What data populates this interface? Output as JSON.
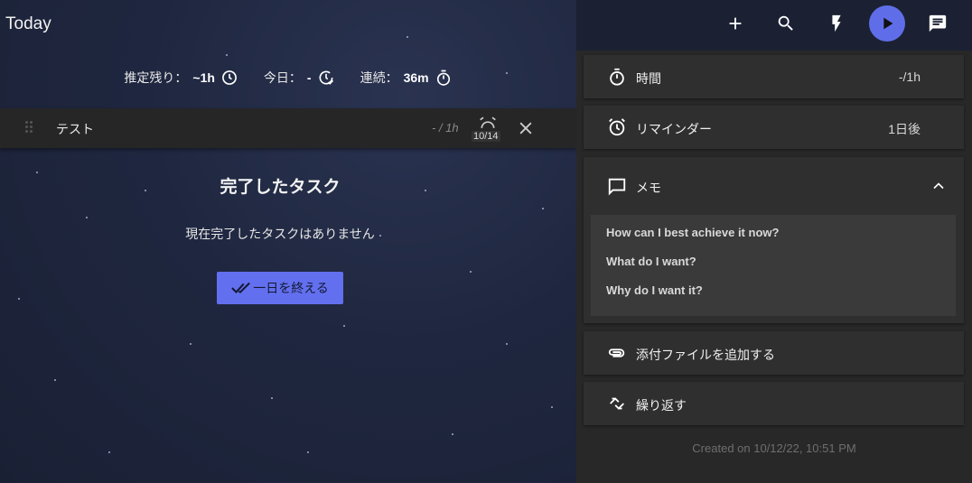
{
  "header": {
    "title": "Today",
    "actions": [
      "add-icon",
      "search-icon",
      "bolt-icon",
      "play-icon",
      "chat-icon"
    ]
  },
  "stats": {
    "remaining_label": "推定残り：",
    "remaining_value": "~1h",
    "today_label": "今日：",
    "today_value": "-",
    "streak_label": "連続：",
    "streak_value": "36m"
  },
  "task": {
    "title": "テスト",
    "estimate": "- / 1h",
    "reminder_date": "10/14"
  },
  "done": {
    "title": "完了したタスク",
    "empty_text": "現在完了したタスクはありません",
    "end_day_label": "一日を終える"
  },
  "details": {
    "time_label": "時間",
    "time_value": "-/1h",
    "reminder_label": "リマインダー",
    "reminder_value": "1日後",
    "memo_label": "メモ",
    "memo_lines": [
      "How can I best achieve it now?",
      "What do I want?",
      "Why do I want it?"
    ],
    "attach_label": "添付ファイルを追加する",
    "repeat_label": "繰り返す",
    "created": "Created on 10/12/22, 10:51 PM"
  },
  "colors": {
    "accent": "#5f6ee8",
    "panel": "#282828",
    "card": "#2f2f2f"
  }
}
